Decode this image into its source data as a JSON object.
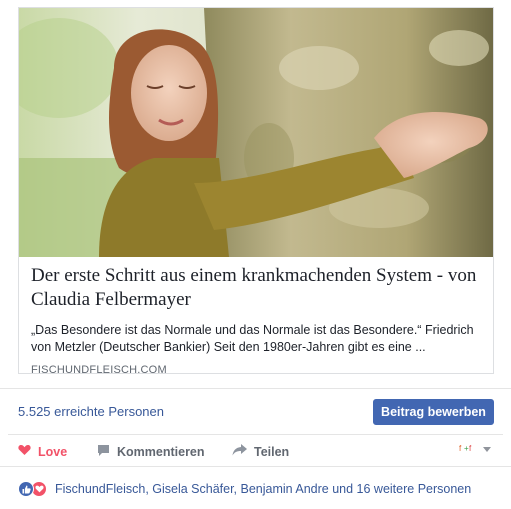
{
  "link_card": {
    "title": "Der erste Schritt aus einem krankmachenden System - von Claudia Felbermayer",
    "description": "„Das Besondere ist das Normale und das Normale ist das Besondere.“ Friedrich von Metzler (Deutscher Bankier) Seit den 1980er-Jahren gibt es eine ...",
    "domain": "FISCHUNDFLEISCH.COM",
    "image_icon": "photo-woman-hugging-tree"
  },
  "reach": {
    "text": "5.525 erreichte Personen",
    "boost_label": "Beitrag bewerben"
  },
  "actions": {
    "love": "Love",
    "comment": "Kommentieren",
    "share": "Teilen"
  },
  "reactions": {
    "names": "FischundFleisch, Gisela Schäfer, Benjamin Andre und 16 weitere Personen"
  },
  "colors": {
    "link_blue": "#385898",
    "button_blue": "#4267b2",
    "love_red": "#f25268",
    "muted_gray": "#616770"
  }
}
